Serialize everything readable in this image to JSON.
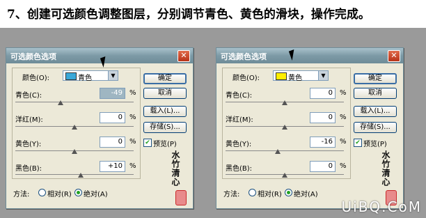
{
  "caption": "7、创建可选颜色调整图层，分别调节青色、黄色的滑块，操作完成。",
  "watermark": "UiBQ.CoM",
  "calligraphy": "水竹清心",
  "dialogs": [
    {
      "title": "可选颜色选项",
      "close": "✕",
      "color_label": "颜色(O):",
      "color_value": "青色",
      "swatch_color": "#3aa8d8",
      "sliders": [
        {
          "label": "青色(C):",
          "value": "-49",
          "selected": true,
          "pos": 0.38
        },
        {
          "label": "洋红(M):",
          "value": "0",
          "selected": false,
          "pos": 0.5
        },
        {
          "label": "黄色(Y):",
          "value": "0",
          "selected": false,
          "pos": 0.5
        },
        {
          "label": "黑色(B):",
          "value": "+10",
          "selected": false,
          "pos": 0.55
        }
      ],
      "pct": "%",
      "buttons": {
        "ok": "确定",
        "cancel": "取消",
        "load": "载入(L)...",
        "save": "存储(S)..."
      },
      "preview_label": "预览(P)",
      "preview_checked": true,
      "method_label": "方法:",
      "relative_label": "相对(R)",
      "absolute_label": "绝对(A)",
      "absolute_selected": true
    },
    {
      "title": "可选颜色选项",
      "close": "✕",
      "color_label": "颜色(O):",
      "color_value": "黄色",
      "swatch_color": "#ffee00",
      "sliders": [
        {
          "label": "青色(C):",
          "value": "0",
          "selected": false,
          "pos": 0.5
        },
        {
          "label": "洋红(M):",
          "value": "0",
          "selected": false,
          "pos": 0.5
        },
        {
          "label": "黄色(Y):",
          "value": "-16",
          "selected": false,
          "pos": 0.44
        },
        {
          "label": "黑色(B):",
          "value": "0",
          "selected": false,
          "pos": 0.5
        }
      ],
      "pct": "%",
      "buttons": {
        "ok": "确定",
        "cancel": "取消",
        "load": "载入(L)...",
        "save": "存储(S)..."
      },
      "preview_label": "预览(P)",
      "preview_checked": true,
      "method_label": "方法:",
      "relative_label": "相对(R)",
      "absolute_label": "绝对(A)",
      "absolute_selected": true
    }
  ]
}
